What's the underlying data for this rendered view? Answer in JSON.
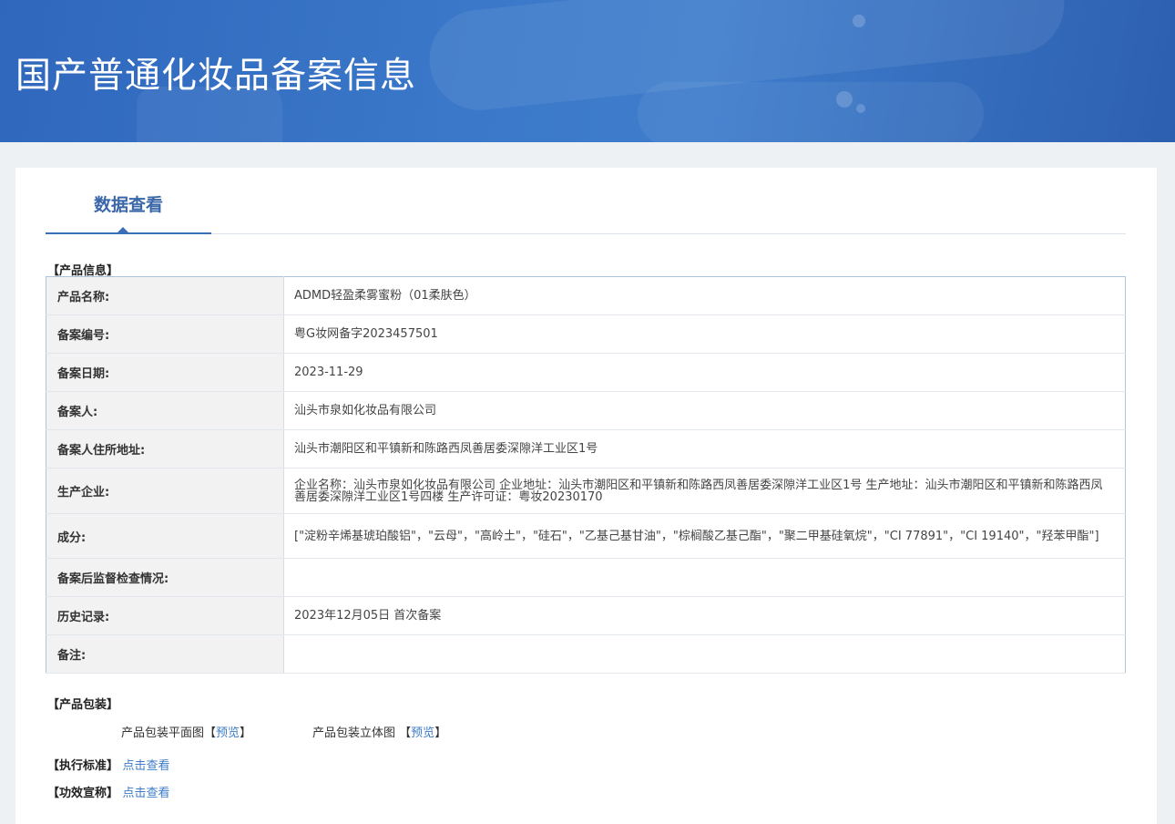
{
  "header": {
    "title": "国产普通化妆品备案信息"
  },
  "tabs": {
    "active": "数据查看"
  },
  "product_info": {
    "section_title": "【产品信息】",
    "rows": [
      {
        "label": "产品名称:",
        "value": "ADMD轻盈柔雾蜜粉（01柔肤色）"
      },
      {
        "label": "备案编号:",
        "value": "粤G妆网备字2023457501"
      },
      {
        "label": "备案日期:",
        "value": "2023-11-29"
      },
      {
        "label": "备案人:",
        "value": "汕头市泉如化妆品有限公司"
      },
      {
        "label": "备案人住所地址:",
        "value": "汕头市潮阳区和平镇新和陈路西凤善居委深隙洋工业区1号"
      },
      {
        "label": "生产企业:",
        "value": "企业名称：汕头市泉如化妆品有限公司 企业地址：汕头市潮阳区和平镇新和陈路西凤善居委深隙洋工业区1号 生产地址：汕头市潮阳区和平镇新和陈路西凤善居委深隙洋工业区1号四楼 生产许可证：粤妆20230170"
      },
      {
        "label": "成分:",
        "value": "[\"淀粉辛烯基琥珀酸铝\"，\"云母\"，\"高岭土\"，\"硅石\"，\"乙基己基甘油\"，\"棕榈酸乙基己酯\"，\"聚二甲基硅氧烷\"，\"CI 77891\"，\"CI 19140\"，\"羟苯甲酯\"]"
      },
      {
        "label": "备案后监督检查情况:",
        "value": ""
      },
      {
        "label": "历史记录:",
        "value": "2023年12月05日 首次备案"
      },
      {
        "label": "备注:",
        "value": ""
      }
    ]
  },
  "packaging": {
    "section_title": "【产品包装】",
    "flat_label": "产品包装平面图",
    "solid_label": "产品包装立体图",
    "preview_label": "预览",
    "open_bracket": "【",
    "close_bracket": "】"
  },
  "standard": {
    "label": "【执行标准】",
    "link": "点击查看"
  },
  "efficacy": {
    "label": "【功效宣称】",
    "link": "点击查看"
  },
  "colors": {
    "banner": "#3b78c9",
    "accent": "#3a67a8",
    "link": "#3d7cc9"
  }
}
